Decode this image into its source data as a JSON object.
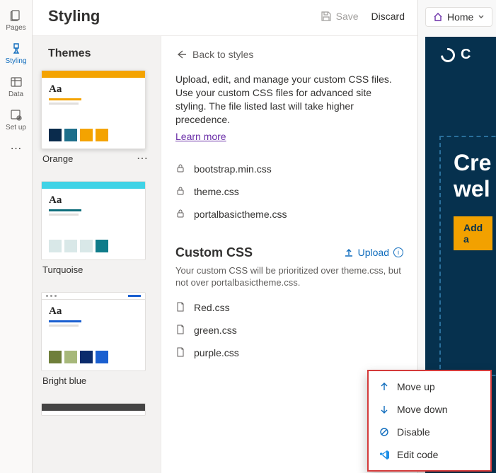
{
  "rail": {
    "items": [
      {
        "label": "Pages",
        "icon": "pages"
      },
      {
        "label": "Styling",
        "icon": "brush"
      },
      {
        "label": "Data",
        "icon": "data"
      },
      {
        "label": "Set up",
        "icon": "setup"
      }
    ]
  },
  "header": {
    "title": "Styling",
    "save_label": "Save",
    "discard_label": "Discard"
  },
  "themes": {
    "heading": "Themes",
    "items": [
      {
        "name": "Orange",
        "topbar": "#f4a300",
        "line_accent": "#f4a300",
        "swatches": [
          "#0a2b4c",
          "#1e6f8b",
          "#f4a300",
          "#f4a300"
        ],
        "selected": true
      },
      {
        "name": "Turquoise",
        "topbar": "#3fd3e6",
        "line_accent": "#0f6e7c",
        "swatches": [
          "#d9e8e8",
          "#d9e8e8",
          "#d9e8e8",
          "#0f7c8a"
        ],
        "selected": false
      },
      {
        "name": "Bright blue",
        "topbar_dots": true,
        "line_accent": "#1a5fd0",
        "swatches": [
          "#6f7f3a",
          "#a7b87a",
          "#0a2b6c",
          "#1a5fd0"
        ],
        "selected": false
      }
    ]
  },
  "styles": {
    "back_label": "Back to styles",
    "description": "Upload, edit, and manage your custom CSS files. Use your custom CSS files for advanced site styling. The file listed last will take higher precedence.",
    "learn_more": "Learn more",
    "built_in": [
      {
        "name": "bootstrap.min.css",
        "locked": true
      },
      {
        "name": "theme.css",
        "locked": true
      },
      {
        "name": "portalbasictheme.css",
        "locked": true
      }
    ],
    "custom_heading": "Custom CSS",
    "upload_label": "Upload",
    "custom_description": "Your custom CSS will be prioritized over theme.css, but not over portalbasictheme.css.",
    "custom_files": [
      {
        "name": "Red.css"
      },
      {
        "name": "green.css"
      },
      {
        "name": "purple.css"
      }
    ]
  },
  "preview": {
    "home_label": "Home",
    "logo_text": "C",
    "hero_line1": "Cre",
    "hero_line2": "wel",
    "hero_button": "Add a"
  },
  "context_menu": {
    "items": [
      {
        "label": "Move up",
        "icon": "up"
      },
      {
        "label": "Move down",
        "icon": "down"
      },
      {
        "label": "Disable",
        "icon": "disable"
      },
      {
        "label": "Edit code",
        "icon": "vscode"
      }
    ]
  }
}
